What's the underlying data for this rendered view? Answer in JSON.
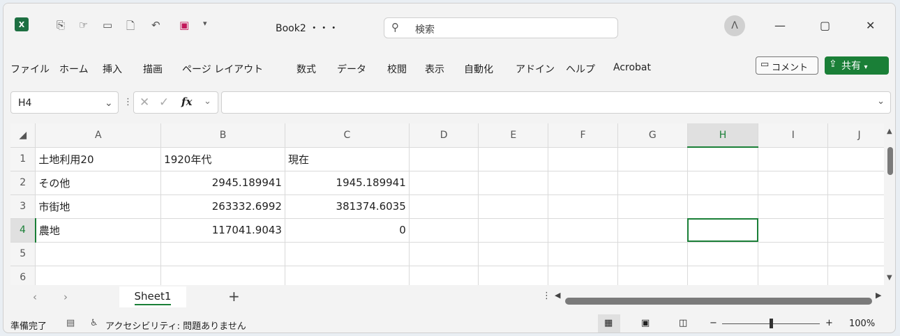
{
  "titlebar": {
    "filename": "Book2 ・・・",
    "search_placeholder": "検索"
  },
  "menu": [
    "ファイル",
    "ホーム",
    "挿入",
    "描画",
    "ページ レイアウト",
    "数式",
    "データ",
    "校閲",
    "表示",
    "自動化",
    "アドイン",
    "ヘルプ",
    "Acrobat"
  ],
  "comment_label": "コメント",
  "share_label": "共有",
  "name_box": "H4",
  "fx_label": "fx",
  "columns": [
    "A",
    "B",
    "C",
    "D",
    "E",
    "F",
    "G",
    "H",
    "I",
    "J"
  ],
  "rows": [
    {
      "n": "1",
      "cells": [
        "土地利用20",
        "1920年代",
        "現在",
        "",
        "",
        "",
        "",
        "",
        "",
        ""
      ]
    },
    {
      "n": "2",
      "cells": [
        "その他",
        "2945.189941",
        "1945.189941",
        "",
        "",
        "",
        "",
        "",
        "",
        ""
      ]
    },
    {
      "n": "3",
      "cells": [
        "市街地",
        "263332.6992",
        "381374.6035",
        "",
        "",
        "",
        "",
        "",
        "",
        ""
      ]
    },
    {
      "n": "4",
      "cells": [
        "農地",
        "117041.9043",
        "0",
        "",
        "",
        "",
        "",
        "",
        "",
        ""
      ]
    },
    {
      "n": "5",
      "cells": [
        "",
        "",
        "",
        "",
        "",
        "",
        "",
        "",
        "",
        ""
      ]
    },
    {
      "n": "6",
      "cells": [
        "",
        "",
        "",
        "",
        "",
        "",
        "",
        "",
        "",
        ""
      ]
    }
  ],
  "sheet_tab": "Sheet1",
  "add_sheet": "+",
  "status": {
    "ready": "準備完了",
    "accessibility": "アクセシビリティ: 問題ありません",
    "zoom": "100%",
    "zoom_minus": "−",
    "zoom_plus": "+"
  }
}
